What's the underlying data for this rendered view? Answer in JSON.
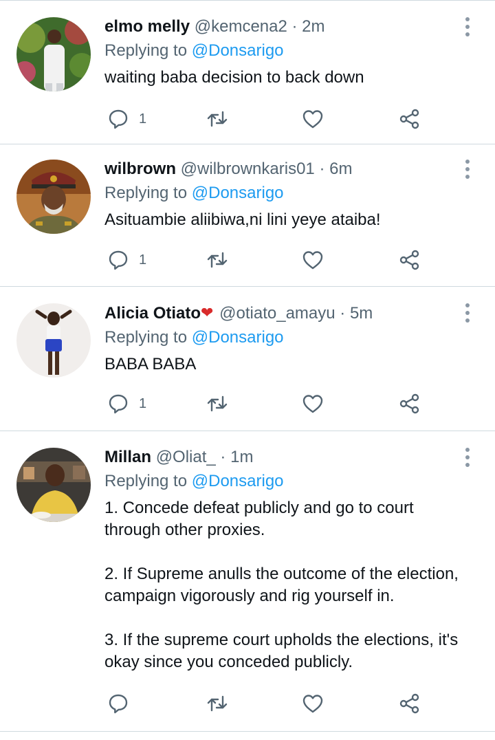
{
  "tweets": [
    {
      "name": "elmo melly",
      "handle": "@kemcena2",
      "dot": "·",
      "time": "2m",
      "replying_prefix": "Replying to",
      "replying_to": "@Donsarigo",
      "paragraphs": [
        "waiting baba decision to back down"
      ],
      "reply_count": "1",
      "avatar": "avatar-photo"
    },
    {
      "name": "wilbrown",
      "handle": "@wilbrownkaris01",
      "dot": "·",
      "time": "6m",
      "replying_prefix": "Replying to",
      "replying_to": "@Donsarigo",
      "paragraphs": [
        "Asituambie aliibiwa,ni lini yeye ataiba!"
      ],
      "reply_count": "1",
      "avatar": "avatar-photo"
    },
    {
      "name": "Alicia Otiato",
      "name_emoji": "❤",
      "handle": "@otiato_amayu",
      "dot": "·",
      "time": "5m",
      "replying_prefix": "Replying to",
      "replying_to": "@Donsarigo",
      "paragraphs": [
        "BABA BABA"
      ],
      "reply_count": "1",
      "avatar": "avatar-photo"
    },
    {
      "name": "Millan",
      "handle": "@Oliat_",
      "dot": "·",
      "time": "1m",
      "replying_prefix": "Replying to",
      "replying_to": "@Donsarigo",
      "paragraphs": [
        "1. Concede defeat publicly and go to court through other proxies.",
        "2. If Supreme anulls the outcome of the election, campaign vigorously and rig yourself in.",
        "3. If the supreme court upholds the elections, it's okay since you conceded publicly."
      ],
      "reply_count": "",
      "avatar": "avatar-photo"
    }
  ],
  "icons": {
    "reply": "reply-icon",
    "retweet": "retweet-icon",
    "like": "heart-icon",
    "share": "share-icon",
    "more": "more-vertical-icon"
  },
  "colors": {
    "link": "#1d9bf0",
    "secondary": "#536471",
    "divider": "#cfd9de",
    "icon": "#536471"
  }
}
